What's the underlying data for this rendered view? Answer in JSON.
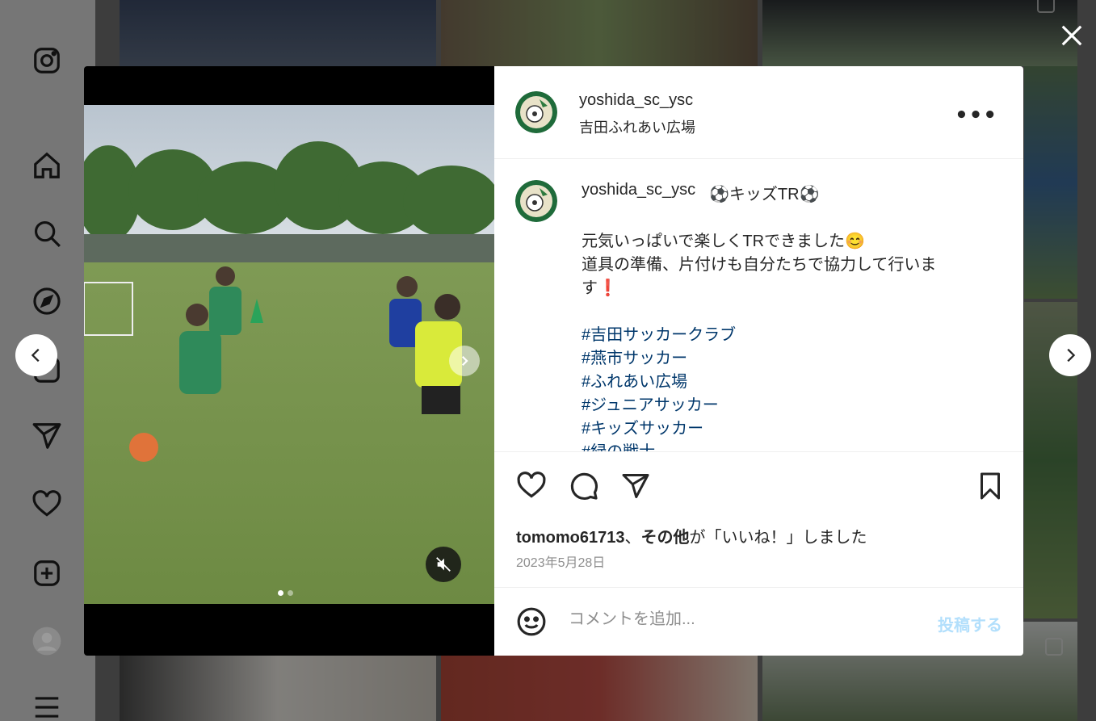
{
  "post": {
    "username": "yoshida_sc_ysc",
    "location": "吉田ふれあい広場",
    "caption_title": "⚽キッズTR⚽",
    "caption_lines": [
      "元気いっぱいで楽しくTRできました😊",
      "道具の準備、片付けも自分たちで協力して行いま",
      "す❗"
    ],
    "hashtags": [
      "#吉田サッカークラブ",
      "#燕市サッカー",
      "#ふれあい広場",
      "#ジュニアサッカー",
      "#キッズサッカー",
      "#緑の戦士"
    ],
    "likes_user": "tomomo61713",
    "likes_sep": "、",
    "likes_others": "その他",
    "likes_suffix": "が「いいね！」しました",
    "date": "2023年5月28日"
  },
  "comment": {
    "placeholder": "コメントを追加...",
    "post_label": "投稿する"
  },
  "carousel": {
    "current": 1,
    "total": 2
  },
  "colors": {
    "link": "#00376b",
    "post_disabled": "#b2dffc",
    "muted": "#8e8e8e"
  }
}
